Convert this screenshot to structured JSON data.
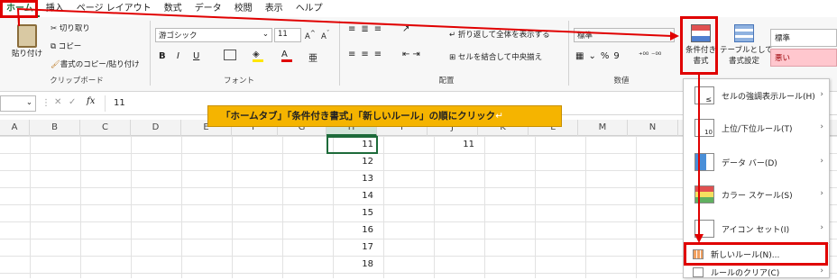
{
  "menu": [
    "ホーム",
    "挿入",
    "ページ レイアウト",
    "数式",
    "データ",
    "校閲",
    "表示",
    "ヘルプ"
  ],
  "clipboard": {
    "paste": "貼り付け",
    "cut": "切り取り",
    "copy": "コピー",
    "format_painter": "書式のコピー/貼り付け",
    "label": "クリップボード"
  },
  "font": {
    "name": "游ゴシック",
    "size": "11",
    "grow": "A^",
    "shrink": "A˅",
    "label": "フォント"
  },
  "alignment": {
    "wrap": "折り返して全体を表示する",
    "merge": "セルを結合して中央揃え",
    "label": "配置"
  },
  "number": {
    "format": "標準",
    "label": "数値"
  },
  "styles": {
    "cond_format_line1": "条件付き",
    "cond_format_line2": "書式",
    "table_line1": "テーブルとして",
    "table_line2": "書式設定",
    "style_normal": "標準",
    "style_bad": "悪い"
  },
  "formula_bar": {
    "fx": "fx",
    "value": "11"
  },
  "columns": [
    "A",
    "B",
    "C",
    "D",
    "E",
    "F",
    "G",
    "H",
    "I",
    "J",
    "K",
    "L",
    "M",
    "N"
  ],
  "cells_h": [
    "11",
    "12",
    "13",
    "14",
    "15",
    "16",
    "17",
    "18"
  ],
  "cell_j": "11",
  "annotation": "「ホームタブ」「条件付き書式」「新しいルール」の順にクリック",
  "dropdown": [
    {
      "label": "セルの強調表示ルール(H)"
    },
    {
      "label": "上位/下位ルール(T)"
    },
    {
      "label": "データ バー(D)"
    },
    {
      "label": "カラー スケール(S)"
    },
    {
      "label": "アイコン セット(I)"
    },
    {
      "label": "新しいルール(N)..."
    },
    {
      "label": "ルールのクリア(C)"
    }
  ],
  "colors": {
    "excel_green": "#1d6b3a",
    "highlight_red": "#e00000",
    "annotation_bg": "#f5b400"
  }
}
